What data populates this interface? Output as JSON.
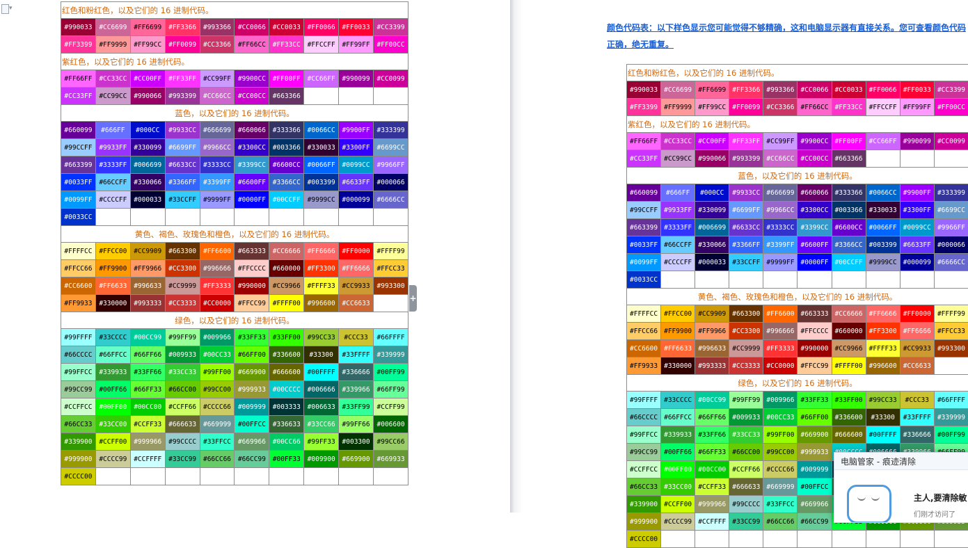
{
  "toolbar": {
    "doc_icon": "document-icon",
    "caret_icon": "chevron-down-icon"
  },
  "divider": {
    "toggle_glyph": "+"
  },
  "note": {
    "line1": "颜色代码表：以下样色显示您可能觉得不够精确，这和电脑显示器有直接关系。您可查看颜色代码",
    "line2": "正确，绝无重复。"
  },
  "headings": {
    "red": "红色和粉红色，以及它们的 16 进制代码。",
    "purple": "紫红色，以及它们的 16 进制代码。",
    "blue": "蓝色，以及它们的 16 进制代码。",
    "yellow": "黄色、褐色、玫瑰色和橙色，以及它们的 16 进制代码。",
    "green": "绿色，以及它们的 16 进制代码。"
  },
  "sections": [
    {
      "key": "red",
      "align": "left",
      "rows": [
        [
          "#990033",
          "#CC6699",
          "#FF6699",
          "#FF3366",
          "#993366",
          "#CC0066",
          "#CC0033",
          "#FF0066",
          "#FF0033",
          "#CC3399"
        ],
        [
          "#FF3399",
          "#FF9999",
          "#FF99CC",
          "#FF0099",
          "#CC3366",
          "#FF66CC",
          "#FF33CC",
          "#FFCCFF",
          "#FF99FF",
          "#FF00CC"
        ]
      ]
    },
    {
      "key": "purple",
      "align": "left",
      "rows": [
        [
          "#FF66FF",
          "#CC33CC",
          "#CC00FF",
          "#FF33FF",
          "#CC99FF",
          "#9900CC",
          "#FF00FF",
          "#CC66FF",
          "#990099",
          "#CC0099"
        ],
        [
          "#CC33FF",
          "#CC99CC",
          "#990066",
          "#993399",
          "#CC66CC",
          "#CC00CC",
          "#663366",
          "",
          "",
          ""
        ]
      ]
    },
    {
      "key": "blue",
      "align": "center",
      "rows": [
        [
          "#660099",
          "#666FF",
          "#000CC",
          "#9933CC",
          "#666699",
          "#660066",
          "#333366",
          "#0066CC",
          "#9900FF",
          "#333399"
        ],
        [
          "#99CCFF",
          "#9933FF",
          "#330099",
          "#6699FF",
          "#9966CC",
          "#3300CC",
          "#003366",
          "#330033",
          "#3300FF",
          "#6699CC"
        ],
        [
          "#663399",
          "#3333FF",
          "#006699",
          "#6633CC",
          "#3333CC",
          "#3399CC",
          "#6600CC",
          "#0066FF",
          "#0099CC",
          "#9966FF"
        ],
        [
          "#0033FF",
          "#66CCFF",
          "#330066",
          "#3366FF",
          "#3399FF",
          "#6600FF",
          "#3366CC",
          "#003399",
          "#6633FF",
          "#000066"
        ],
        [
          "#0099FF",
          "#CCCCFF",
          "#000033",
          "#33CCFF",
          "#9999FF",
          "#0000FF",
          "#00CCFF",
          "#9999CC",
          "#000099",
          "#6666CC"
        ],
        [
          "#0033CC",
          "",
          "",
          "",
          "",
          "",
          "",
          "",
          "",
          ""
        ]
      ]
    },
    {
      "key": "yellow",
      "align": "center",
      "rows": [
        [
          "#FFFFCC",
          "#FFCC00",
          "#CC9909",
          "#663300",
          "#FF6600",
          "#663333",
          "#CC6666",
          "#FF6666",
          "#FF0000",
          "#FFFF99"
        ],
        [
          "#FFCC66",
          "#FF9900",
          "#FF9966",
          "#CC3300",
          "#996666",
          "#FFCCCC",
          "#660000",
          "#FF3300",
          "#FF6666",
          "#FFCC33"
        ],
        [
          "#CC6600",
          "#FF6633",
          "#996633",
          "#CC9999",
          "#FF3333",
          "#990000",
          "#CC9966",
          "#FFFF33",
          "#CC9933",
          "#993300"
        ],
        [
          "#FF9933",
          "#330000",
          "#993333",
          "#CC3333",
          "#CC0000",
          "#FFCC99",
          "#FFFF00",
          "#996600",
          "#CC6633",
          ""
        ]
      ]
    },
    {
      "key": "green",
      "align": "center",
      "rows": [
        [
          "#99FFFF",
          "#33CCCC",
          "#00CC99",
          "#99FF99",
          "#009966",
          "#33FF33",
          "#33FF00",
          "#99CC33",
          "#CCC33",
          "#66FFFF"
        ],
        [
          "#66CCCC",
          "#66FFCC",
          "#66FF66",
          "#009933",
          "#00CC33",
          "#66FF00",
          "#336600",
          "#33300",
          "#33FFFF",
          "#339999"
        ],
        [
          "#99FFCC",
          "#339933",
          "#33FF66",
          "#33CC33",
          "#99FF00",
          "#669900",
          "#666600",
          "#00FFFF",
          "#336666",
          "#00FF99"
        ],
        [
          "#99CC99",
          "#00FF66",
          "#66FF33",
          "#66CC00",
          "#99CC00",
          "#999933",
          "#00CCCC",
          "#006666",
          "#339966",
          "#66FF99"
        ],
        [
          "#CCFFCC",
          "#00FF00",
          "#00CC00",
          "#CCFF66",
          "#CCCC66",
          "#009999",
          "#003333",
          "#006633",
          "#33FF99",
          "#CCFF99"
        ],
        [
          "#66CC33",
          "#33CC00",
          "#CCFF33",
          "#666633",
          "#669999",
          "#00FFCC",
          "#336633",
          "#33CC66",
          "#99FF66",
          "#006600"
        ],
        [
          "#339900",
          "#CCFF00",
          "#999966",
          "#99CCCC",
          "#33FFCC",
          "#669966",
          "#00CC66",
          "#99FF33",
          "#003300",
          "#99CC66"
        ],
        [
          "#999900",
          "#CCCC99",
          "#CCFFFF",
          "#33CC99",
          "#66CC66",
          "#66CC99",
          "#00FF33",
          "#009900",
          "#669900",
          "#669933"
        ],
        [
          "#CCCC00",
          "",
          "",
          "",
          "",
          "",
          "",
          "",
          "",
          ""
        ]
      ]
    }
  ],
  "cell_overrides": {
    "#FFCC99": "#FFCC99",
    "#FFCCCC": "#FFCCCC",
    "#FFCCFF": "#FFCCFF"
  },
  "popup": {
    "title": "电脑管家 - 痕迹清除",
    "message": "主人,要清除敏",
    "sub": "们刚才访问了",
    "mascot_icon": "mascot-icon"
  }
}
